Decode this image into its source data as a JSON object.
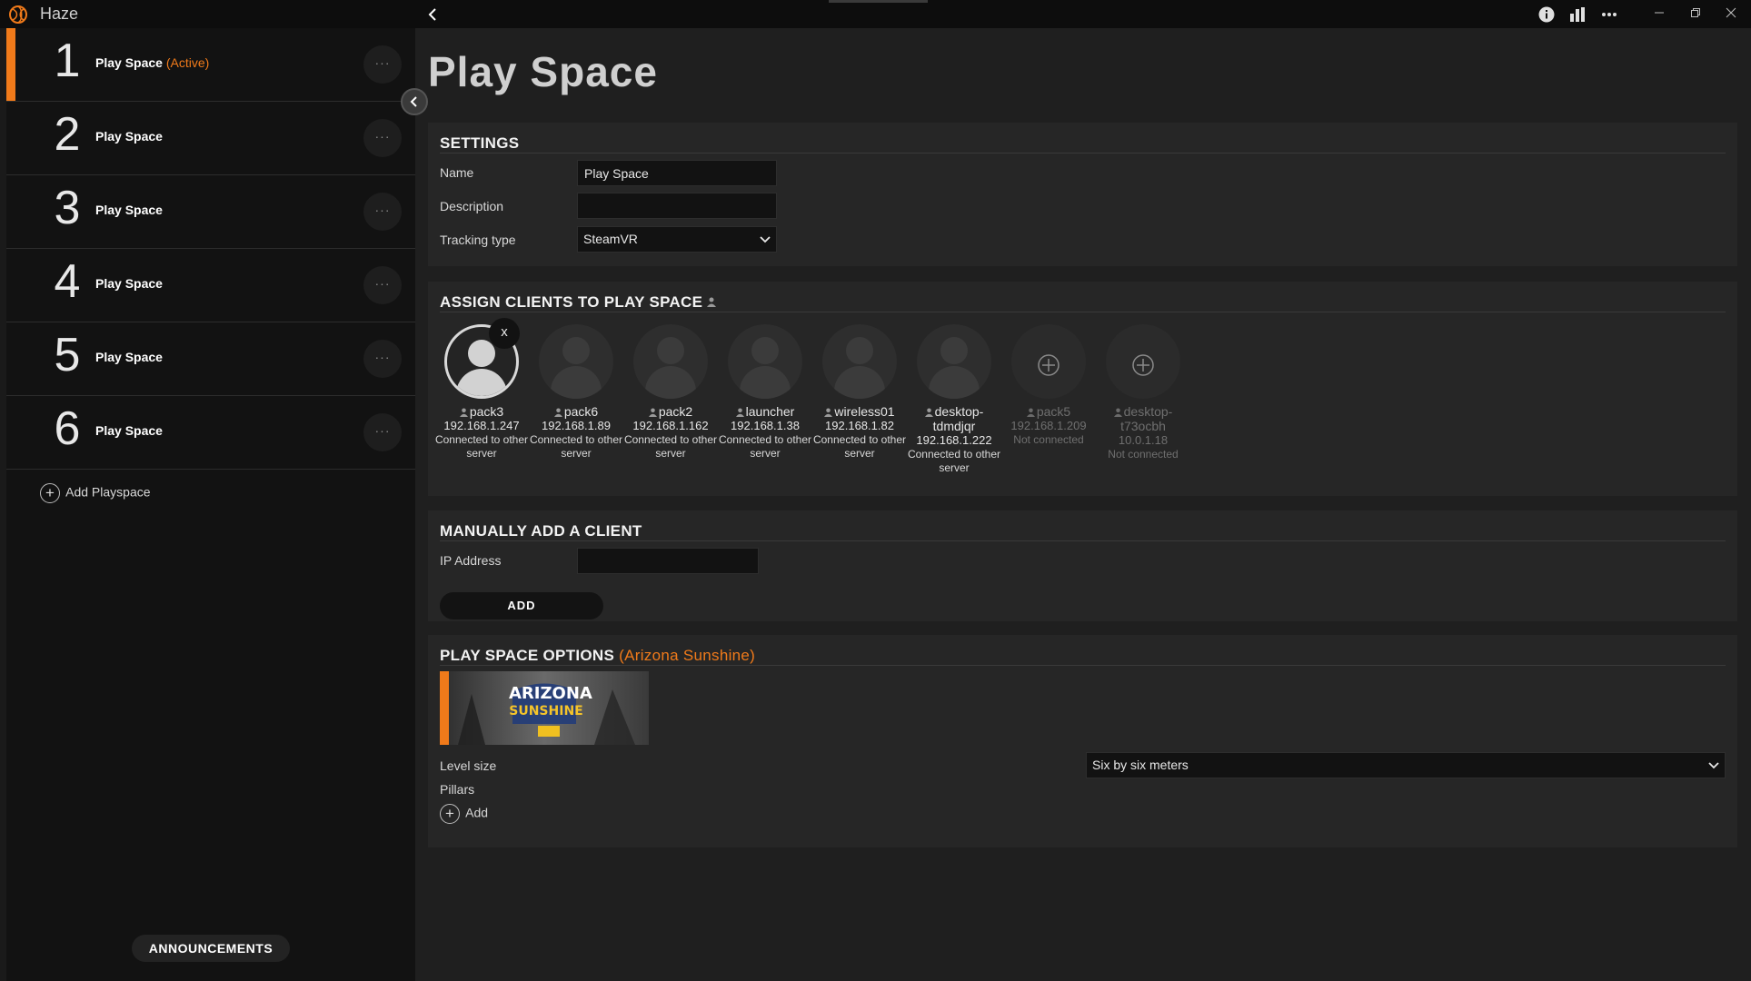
{
  "titlebar": {
    "app_name": "Haze",
    "icons": [
      "info-icon",
      "stats-icon",
      "more-icon"
    ],
    "window_controls": [
      "minimize",
      "restore",
      "close"
    ]
  },
  "sidebar": {
    "items": [
      {
        "number": "1",
        "label": "Play Space",
        "status": "(Active)"
      },
      {
        "number": "2",
        "label": "Play Space"
      },
      {
        "number": "3",
        "label": "Play Space"
      },
      {
        "number": "4",
        "label": "Play Space"
      },
      {
        "number": "5",
        "label": "Play Space"
      },
      {
        "number": "6",
        "label": "Play Space"
      }
    ],
    "more_label": "···",
    "add_label": "Add Playspace",
    "announcements_label": "ANNOUNCEMENTS"
  },
  "main": {
    "title": "Play Space",
    "settings": {
      "heading": "SETTINGS",
      "name_label": "Name",
      "name_value": "Play Space",
      "description_label": "Description",
      "description_value": "",
      "tracking_label": "Tracking type",
      "tracking_value": "SteamVR"
    },
    "clients": {
      "heading": "ASSIGN CLIENTS TO PLAY SPACE",
      "items": [
        {
          "name": "pack3",
          "ip": "192.168.1.247",
          "status": "Connected to other server",
          "state": "assigned"
        },
        {
          "name": "pack6",
          "ip": "192.168.1.89",
          "status": "Connected to other server",
          "state": "connected"
        },
        {
          "name": "pack2",
          "ip": "192.168.1.162",
          "status": "Connected to other server",
          "state": "connected"
        },
        {
          "name": "launcher",
          "ip": "192.168.1.38",
          "status": "Connected to other server",
          "state": "connected"
        },
        {
          "name": "wireless01",
          "ip": "192.168.1.82",
          "status": "Connected to other server",
          "state": "connected"
        },
        {
          "name": "desktop-tdmdjqr",
          "ip": "192.168.1.222",
          "status": "Connected to other server",
          "state": "connected"
        },
        {
          "name": "pack5",
          "ip": "192.168.1.209",
          "status": "Not connected",
          "state": "offline"
        },
        {
          "name": "desktop-t73ocbh",
          "ip": "10.0.1.18",
          "status": "Not connected",
          "state": "offline"
        }
      ],
      "remove_label": "x"
    },
    "manual": {
      "heading": "MANUALLY ADD A CLIENT",
      "ip_label": "IP Address",
      "ip_value": "",
      "add_label": "ADD"
    },
    "options": {
      "heading": "PLAY SPACE OPTIONS",
      "game": "(Arizona Sunshine)",
      "thumb_line1": "ARIZONA",
      "thumb_line2": "SUNSHINE",
      "level_label": "Level size",
      "level_value": "Six by six meters",
      "pillars_label": "Pillars",
      "add_label": "Add"
    }
  },
  "colors": {
    "accent": "#f07a1a",
    "background": "#1f1f1f",
    "sidebar": "#121212",
    "panel": "#262626"
  }
}
